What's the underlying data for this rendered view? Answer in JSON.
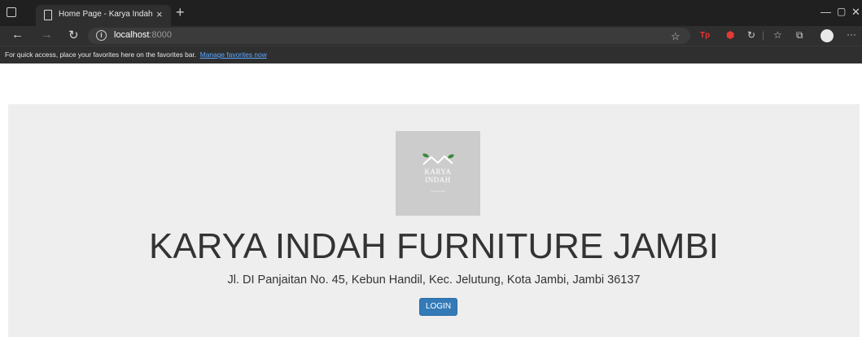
{
  "browser": {
    "tab": {
      "title": "Home Page - Karya Indah Furniture Jambi",
      "close_glyph": "×"
    },
    "new_tab_glyph": "+",
    "window_controls": {
      "minimize": "—",
      "restore": "▢",
      "close": "✕"
    },
    "nav": {
      "back": "←",
      "forward": "→",
      "refresh": "↻"
    },
    "address": {
      "host": "localhost",
      "port": ":8000",
      "info": "i"
    },
    "toolbar_icons": [
      "read-aloud-icon",
      "extension-icon",
      "adblock-icon",
      "refresh-extension-icon",
      "favorites-icon",
      "collections-icon",
      "profile-avatar",
      "more-icon"
    ],
    "toolbar_glyphs": {
      "favorite": "☆",
      "ext1": "Tp",
      "ext2": "⬢",
      "ext3": "↻",
      "favorites": "☆",
      "collections": "⧉",
      "more": "···"
    },
    "favorites_bar": {
      "message": "For quick access, place your favorites here on the favorites bar.",
      "link": "Manage favorites now"
    }
  },
  "page": {
    "logo": {
      "line1": "KARYA",
      "line2": "INDAH",
      "line3": "FURNITURE"
    },
    "title": "KARYA INDAH FURNITURE JAMBI",
    "address": "Jl. DI Panjaitan No. 45, Kebun Handil, Kec. Jelutung, Kota Jambi, Jambi 36137",
    "login_label": "LOGIN"
  },
  "colors": {
    "jumbotron": "#eeeeee",
    "button": "#337ab7",
    "logo_bg": "#cccccc",
    "accent_leaf": "#3a8a3a"
  }
}
